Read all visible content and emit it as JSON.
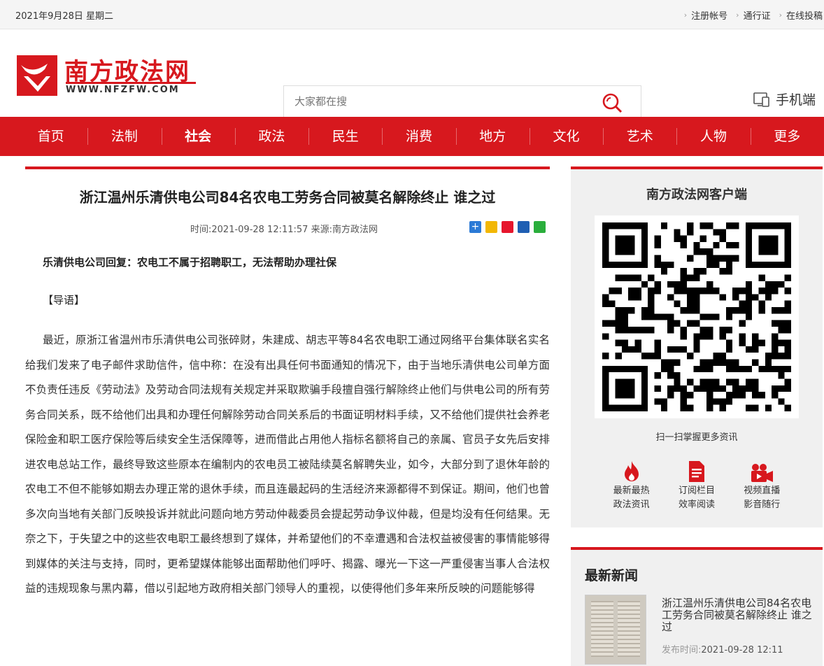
{
  "topbar": {
    "date": "2021年9月28日 星期二",
    "links": [
      "注册帐号",
      "通行证",
      "在线投稿"
    ]
  },
  "logo": {
    "name": "南方政法网",
    "domain": "WWW.NFZFW.COM"
  },
  "search": {
    "placeholder": "大家都在搜"
  },
  "mobile": {
    "label": "手机端"
  },
  "nav": {
    "items": [
      "首页",
      "法制",
      "社会",
      "政法",
      "民生",
      "消费",
      "地方",
      "文化",
      "艺术",
      "人物",
      "更多"
    ],
    "active": "社会"
  },
  "article": {
    "title": "浙江温州乐清供电公司84名农电工劳务合同被莫名解除终止 谁之过",
    "meta": "时间:2021-09-28 12:11:57 来源:南方政法网",
    "lead": "乐清供电公司回复：农电工不属于招聘职工，无法帮助办理社保",
    "guide": "【导语】",
    "body": "最近，原浙江省温州市乐清供电公司张碎财，朱建成、胡志平等84名农电职工通过网络平台集体联名实名给我们发来了电子邮件求助信件，信中称：在没有出具任何书面通知的情况下，由于当地乐清供电公司单方面不负责任违反《劳动法》及劳动合同法规有关规定并采取欺骗手段擅自强行解除终止他们与供电公司的所有劳务合同关系，既不给他们出具和办理任何解除劳动合同关系后的书面证明材料手续，又不给他们提供社会养老保险金和职工医疗保险等后续安全生活保障等，进而借此占用他人指标名额将自己的亲属、官员子女先后安排进农电总站工作，最终导致这些原本在编制内的农电员工被陆续莫名解聘失业，如今，大部分到了退休年龄的农电工不但不能够如期去办理正常的退休手续，而且连最起码的生活经济来源都得不到保证。期间，他们也曾多次向当地有关部门反映投诉并就此问题向地方劳动仲裁委员会提起劳动争议仲裁，但是均没有任何结果。无奈之下，于失望之中的这些农电职工最终想到了媒体，并希望他们的不幸遭遇和合法权益被侵害的事情能够得到媒体的关注与支持，同时，更希望媒体能够出面帮助他们呼吁、揭露、曝光一下这一严重侵害当事人合法权益的违规现象与黑内幕，借以引起地方政府相关部门领导人的重视，以使得他们多年来所反映的问题能够得"
  },
  "sidebar": {
    "app": {
      "title": "南方政法网客户端",
      "scan": "扫一扫掌握更多资讯",
      "features": [
        {
          "line1": "最新最热",
          "line2": "政法资讯",
          "icon": "fire-icon",
          "color": "#d7181e"
        },
        {
          "line1": "订阅栏目",
          "line2": "效率阅读",
          "icon": "document-icon",
          "color": "#d7181e"
        },
        {
          "line1": "视频直播",
          "line2": "影音随行",
          "icon": "video-icon",
          "color": "#d7181e"
        }
      ]
    },
    "news": {
      "title": "最新新闻",
      "headline": "浙江温州乐清供电公司84名农电工劳务合同被莫名解除终止 谁之过",
      "time_label": "发布时间:",
      "time": "2021-09-28 12:11"
    }
  },
  "colors": {
    "brand": "#d7181e"
  }
}
